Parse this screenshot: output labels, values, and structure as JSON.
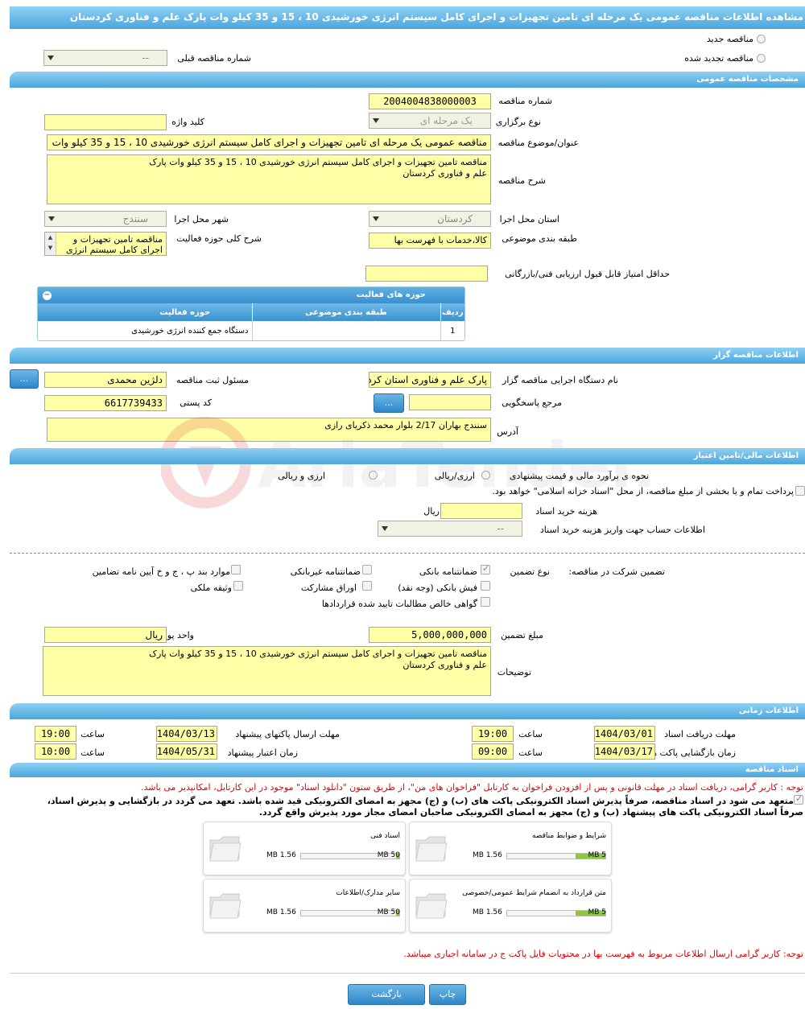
{
  "page_title": "مشاهده اطلاعات مناقصه عمومی یک مرحله ای تامین تجهیزات و اجرای کامل سیستم انرژی خورشیدی 10 ، 15 و 35 کیلو وات پارک علم و فناوری کردستان",
  "top": {
    "new_label": "مناقصه جدید",
    "renew_label": "مناقصه تجدید شده",
    "prev_label": "شماره مناقصه قبلی",
    "prev_value": "--"
  },
  "general": {
    "header": "مشخصات مناقصه عمومی",
    "number_label": "شماره مناقصه",
    "number_value": "2004004838000003",
    "type_label": "نوع برگزاری",
    "type_value": "یک مرحله ای",
    "keyword_label": "کلید واژه",
    "keyword_value": "",
    "title_label": "عنوان/موضوع مناقصه",
    "title_value": "مناقصه عمومی یک مرحله ای  تامین تجهیزات و اجرای کامل سیستم انرژی خورشیدی 10 ، 15 و 35 کیلو وات",
    "desc_label": "شرح مناقصه",
    "desc_value": "مناقصه تامین تجهیزات و اجرای کامل سیستم انرژی خورشیدی 10 ، 15 و 35 کیلو وات پارک علم و فناوری کردستان",
    "province_label": "استان محل اجرا",
    "province_value": "کردستان",
    "city_label": "شهر محل اجرا",
    "city_value": "سنندج",
    "category_label": "طبقه بندی موضوعی",
    "category_value": "کالا،خدمات با فهرست بها",
    "scope_label": "شرح کلی حوزه فعالیت",
    "scope_value": "مناقصه تامین تجهیزات و اجرای کامل سیستم انرژی",
    "min_score_label": "حداقل امتیاز قابل قبول ارزیابی فنی/بازرگانی",
    "min_score_value": ""
  },
  "activity": {
    "header": "حوزه های فعالیت",
    "col_row": "ردیف",
    "col_cat": "طبقه بندی موضوعی",
    "col_area": "حوزه فعالیت",
    "rows": [
      {
        "row": "1",
        "cat": "",
        "area": "دستگاه جمع کننده انرژی خورشیدی"
      }
    ]
  },
  "org": {
    "header": "اطلاعات مناقصه گزار",
    "org_label": "نام دستگاه اجرایی مناقصه گزار",
    "org_value": "پارک علم و فناوری استان کردستان",
    "resp_label": "مسئول ثبت مناقصه",
    "resp_value": "دلژین محمدی",
    "ref_label": "مرجع پاسخگویی",
    "ref_value": "",
    "postal_label": "کد پستی",
    "postal_value": "6617739433",
    "addr_label": "آدرس",
    "addr_value": "سنندج بهاران  2/17 بلوار محمد ذکریای رازی",
    "dots": "..."
  },
  "finance": {
    "header": "اطلاعات مالی/تامین اعتبار",
    "estimate_label": "نحوه ی برآورد مالی و قیمت پیشنهادی",
    "opt1": "ارزی/ریالی",
    "opt2": "ارزی و ریالی",
    "treasury_text": "پرداخت تمام و یا بخشی از مبلغ مناقصه، از محل \"اسناد خزانه اسلامی\" خواهد بود.",
    "doc_cost_label": "هزینه خرید اسناد",
    "doc_cost_value": "",
    "doc_cost_unit": "ریال",
    "account_label": "اطلاعات حساب جهت واریز هزینه خرید اسناد",
    "account_value": "--"
  },
  "guarantee": {
    "label": "تضمین شرکت در مناقصه:",
    "type_label": "نوع تضمین",
    "items": [
      "ضمانتنامه بانکی",
      "ضمانتنامه غیربانکی",
      "موارد بند پ ، ج و خ آیین نامه تضامین",
      "فیش بانکی (وجه نقد)",
      "اوراق مشارکت",
      "وثیقه ملکی",
      "گواهی خالص مطالبات تایید شده قراردادها"
    ],
    "amount_label": "مبلغ تضمین",
    "amount_value": "5,000,000,000",
    "currency_label": "واحد پول",
    "currency_value": "ریال",
    "notes_label": "توضیحات",
    "notes_value": "مناقصه تامین تجهیزات و اجرای کامل سیستم انرژی خورشیدی 10 ، 15 و 35 کیلو وات پارک علم و فناوری کردستان"
  },
  "timing": {
    "header": "اطلاعات زمانی",
    "receive_label": "مهلت دریافت اسناد",
    "receive_date": "1404/03/01",
    "receive_time": "19:00",
    "send_label": "مهلت ارسال پاکتهای پیشنهاد",
    "send_date": "1404/03/13",
    "send_time": "19:00",
    "open_label": "زمان بازگشایی پاکت ها",
    "open_date": "1404/03/17",
    "open_time": "09:00",
    "valid_label": "زمان اعتبار پیشنهاد",
    "valid_date": "1404/05/31",
    "valid_time": "10:00",
    "time_label": "ساعت"
  },
  "docs": {
    "header": "اسناد مناقصه",
    "note1": "توجه : کاربر گرامی، دریافت اسناد در مهلت قانونی و پس از افزودن فراخوان به کارتابل \"فراخوان های من\"، از طریق ستون \"دانلود اسناد\" موجود در این کارتابل، امکانپذیر می باشد.",
    "note2": "متعهد می شود در اسناد مناقصه، صرفاً پذیرش اسناد الکترونیکی پاکت های (ب) و (ج) مجهز به امضای الکترونیکی قید شده باشد. تعهد می گردد در بازگشایی و پذیرش اسناد،",
    "note3": "صرفاً اسناد الکترونیکی پاکت های پیشنهاد (ب) و (ج) مجهز به امضای الکترونیکی صاحبان امضای مجاز مورد پذیرش واقع گردد.",
    "cards": [
      {
        "title": "شرایط و ضوابط مناقصه",
        "max": "5 MB",
        "cur": "1.56 MB",
        "pct": 0.3
      },
      {
        "title": "اسناد فنی",
        "max": "50 MB",
        "cur": "1.56 MB",
        "pct": 0.03
      },
      {
        "title": "متن قرارداد به انضمام شرایط عمومی/خصوصی",
        "max": "5 MB",
        "cur": "1.56 MB",
        "pct": 0.3
      },
      {
        "title": "سایر مدارک/اطلاعات",
        "max": "50 MB",
        "cur": "1.56 MB",
        "pct": 0.03
      }
    ],
    "note4": "توجه: کاربر گرامی ارسال اطلاعات مربوط به فهرست بها در محتویات فایل پاکت ج در سامانه اجباری میباشد."
  },
  "buttons": {
    "print": "چاپ",
    "back": "بازگشت"
  },
  "watermark": "AriaTender.neT"
}
